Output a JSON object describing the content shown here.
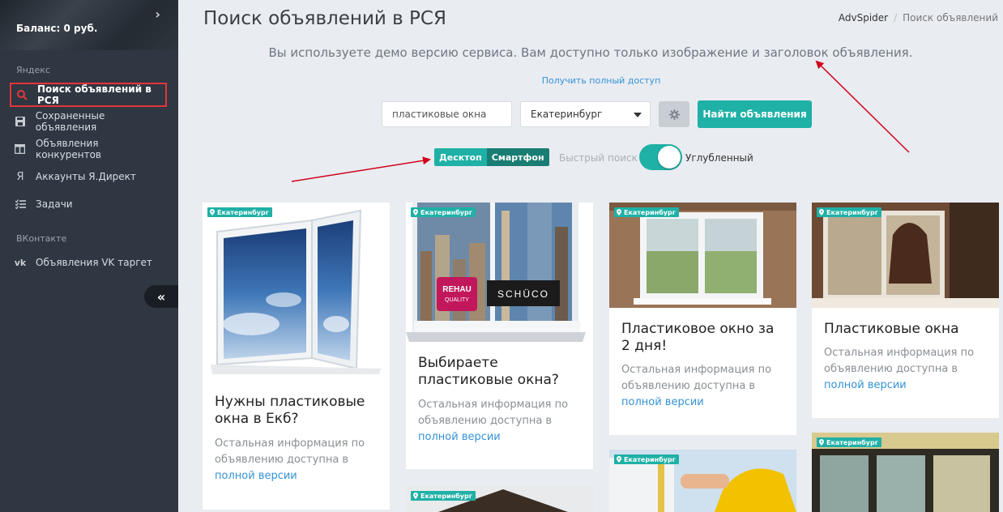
{
  "sidebar": {
    "balance": "Баланс: 0 руб.",
    "section_yandex": "Яндекс",
    "section_vk": "ВКонтакте",
    "items": [
      {
        "label": "Поиск объявлений в РСЯ",
        "icon": "search-icon"
      },
      {
        "label": "Сохраненные объявления",
        "icon": "save-icon"
      },
      {
        "label": "Объявления конкурентов",
        "icon": "columns-icon"
      },
      {
        "label": "Аккаунты Я.Директ",
        "icon": "yandex-icon"
      },
      {
        "label": "Задачи",
        "icon": "tasks-icon"
      },
      {
        "label": "Объявления VK таргет",
        "icon": "vk-icon"
      }
    ]
  },
  "header": {
    "title": "Поиск объявлений в РСЯ",
    "breadcrumb": [
      "AdvSpider",
      "Поиск объявлений"
    ]
  },
  "notice": {
    "demo": "Вы используете демо версию сервиса. Вам доступно только изображение и заголовок объявления.",
    "full_access_link": "Получить полный доступ"
  },
  "search": {
    "query": "пластиковые окна",
    "city": "Екатеринбург",
    "submit_label": "Найти объявления"
  },
  "mode": {
    "desktop": "Десктоп",
    "smartphone": "Смартфон",
    "quick_label": "Быстрый поиск",
    "deep_label": "Углубленный",
    "deep_enabled": true
  },
  "cards": [
    {
      "geo": "Екатеринбург",
      "title": "Нужны пластиковые окна в Екб?",
      "info": "Остальная информация по объявлению доступна в",
      "link": "полной версии"
    },
    {
      "geo": "Екатеринбург",
      "title": "Выбираете пластиковые окна?",
      "info": "Остальная информация по объявлению доступна в",
      "link": "полной версии",
      "brand1": "REHAU",
      "brand1b": "QUALITY",
      "brand2": "SCHÜCO"
    },
    {
      "geo": "Екатеринбург",
      "title": "Пластиковое окно за 2 дня!",
      "info": "Остальная информация по объявлению доступна в",
      "link": "полной версии"
    },
    {
      "geo": "Екатеринбург",
      "title": "Пластиковые окна",
      "info": "Остальная информация по объявлению доступна в",
      "link": "полной версии"
    },
    {
      "geo": "Екатеринбург"
    },
    {
      "geo": "Екатеринбург"
    },
    {
      "geo": "Екатеринбург"
    }
  ],
  "colors": {
    "accent": "#1fb0a6",
    "link": "#3592d6",
    "sidebar": "#2f3742",
    "highlight": "#e5343b"
  }
}
